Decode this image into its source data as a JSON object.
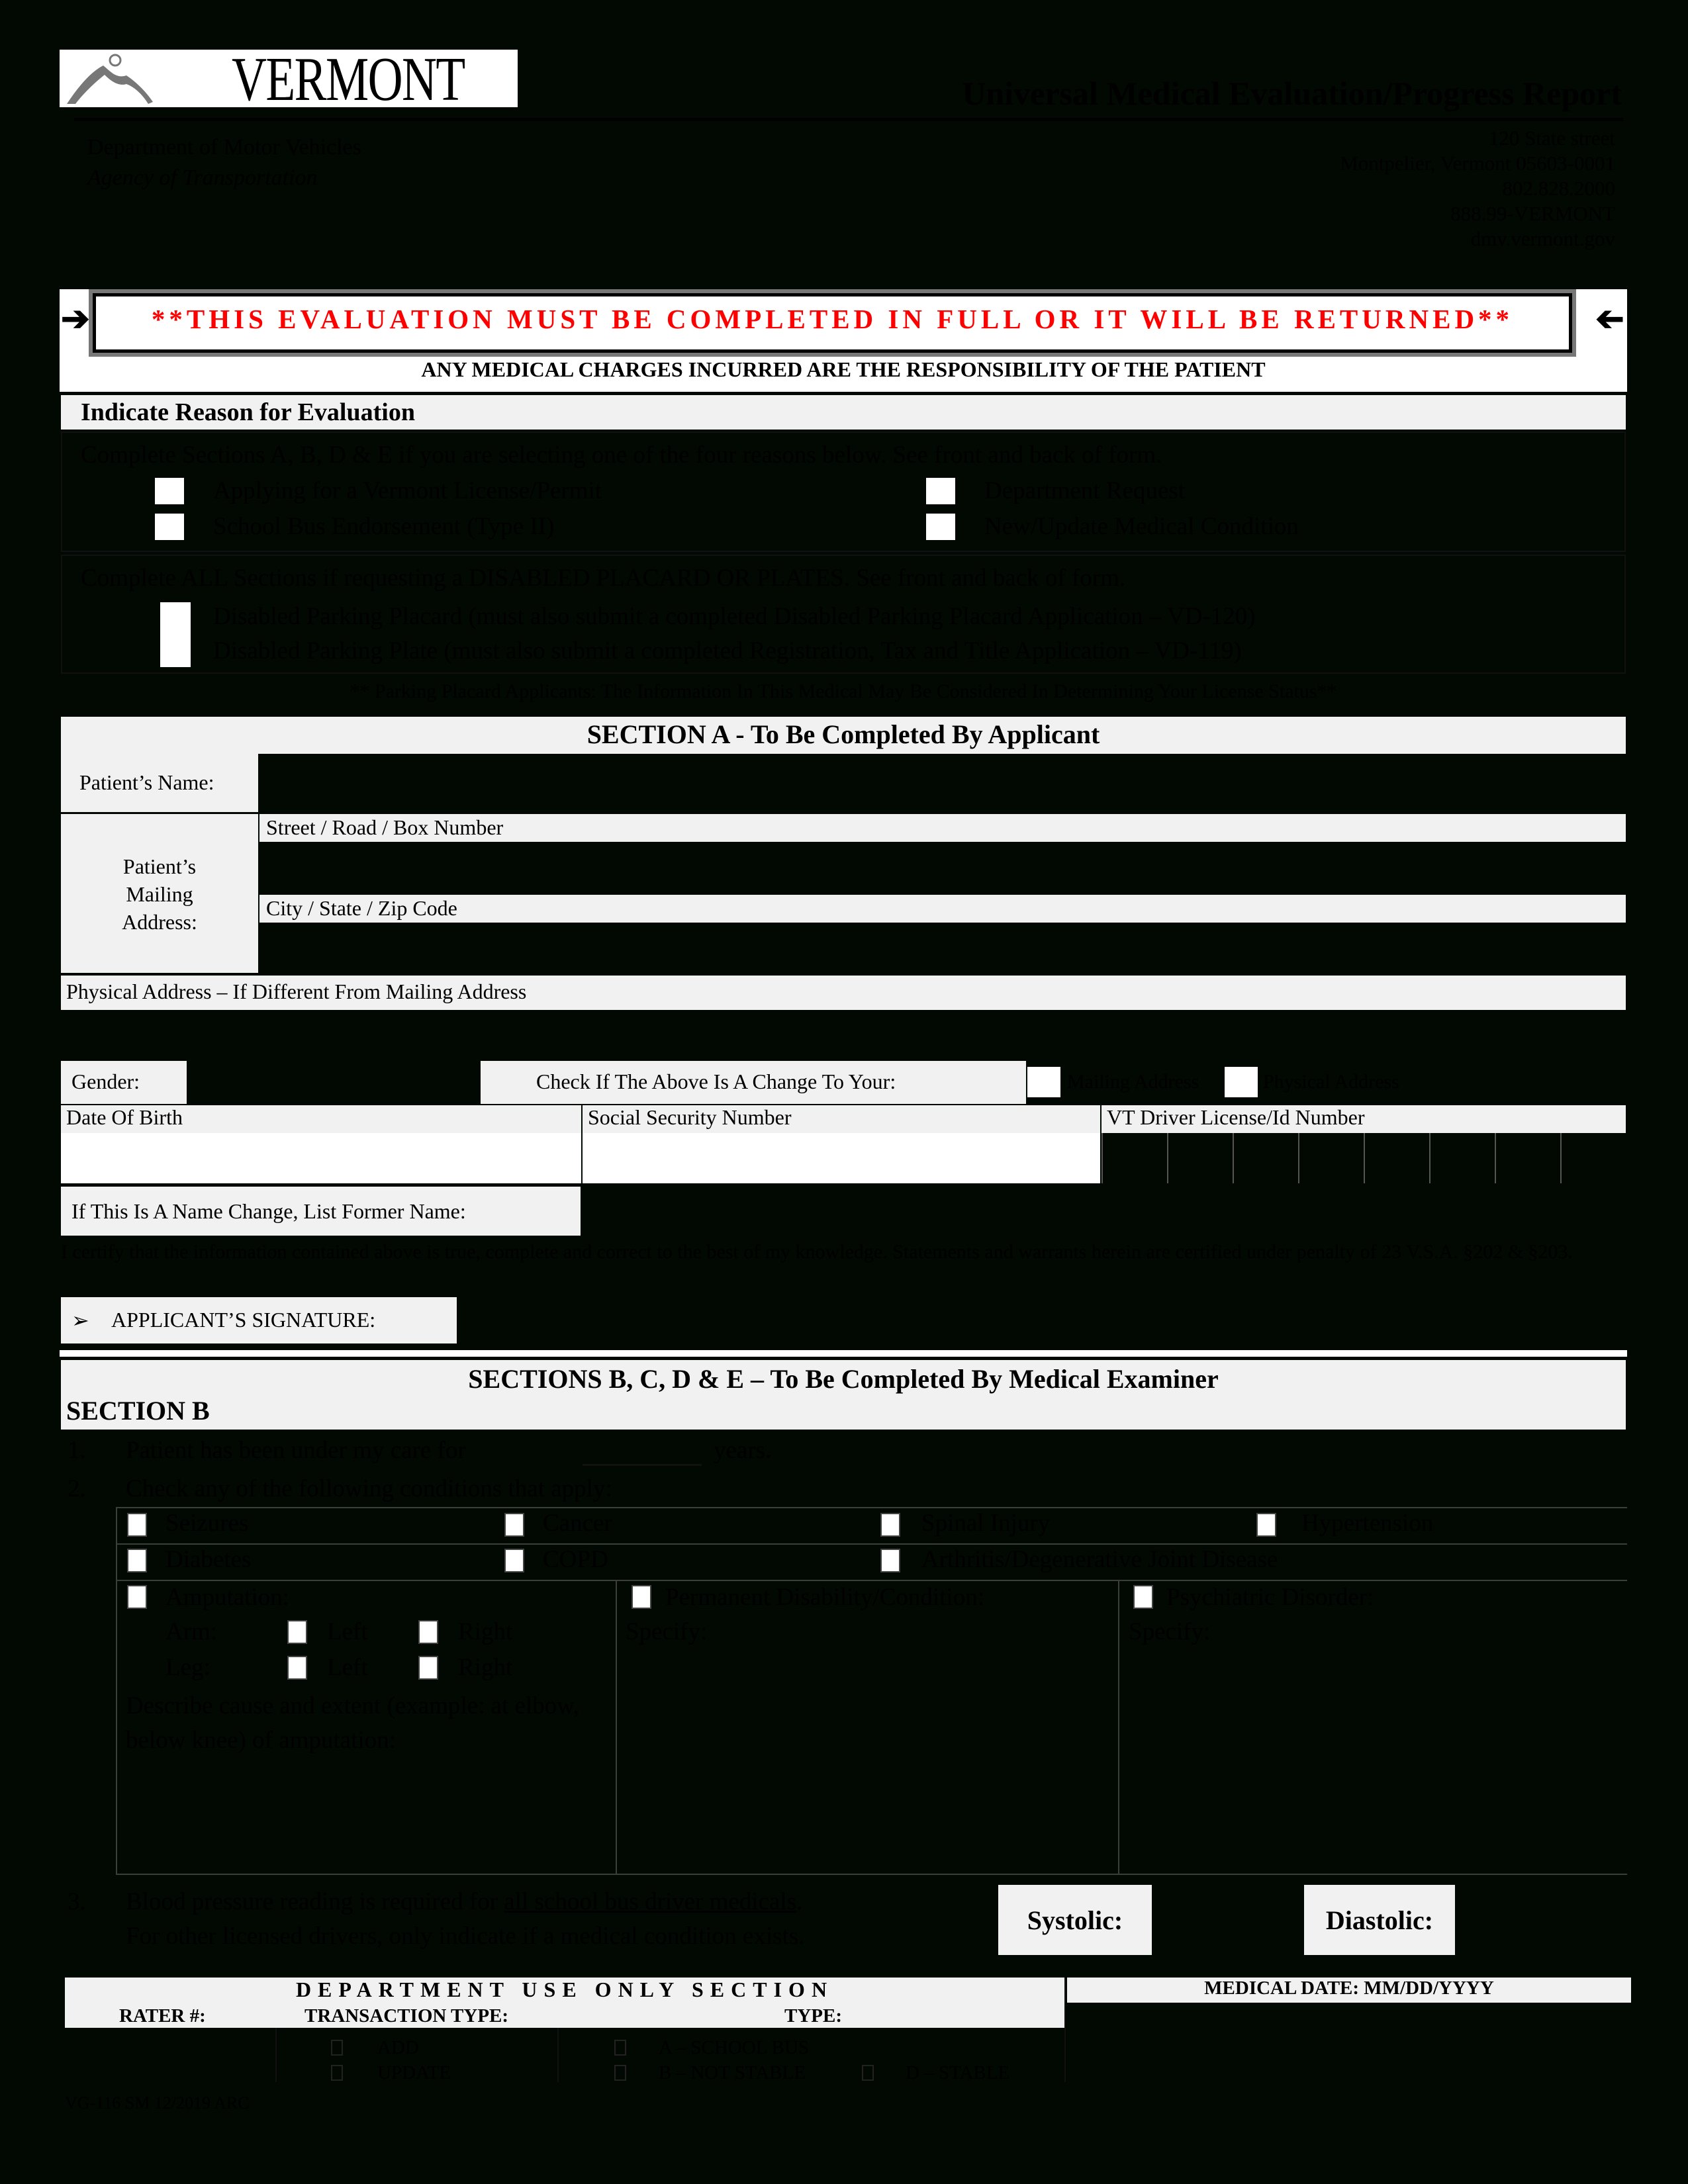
{
  "header": {
    "logo_text": "VERMONT",
    "title": "Universal Medical Evaluation/Progress Report",
    "department": "Department of Motor Vehicles",
    "agency": "Agency of Transportation",
    "address_lines": [
      "120 State street",
      "Montpelier, Vermont 05603-0001",
      "802.828.2000",
      "888.99-VERMONT",
      "dmv.vermont.gov"
    ]
  },
  "banner": {
    "warning": "**THIS EVALUATION MUST BE COMPLETED IN FULL OR IT WILL BE RETURNED**",
    "charges": "ANY MEDICAL CHARGES INCURRED ARE THE RESPONSIBILITY OF THE PATIENT",
    "left_arrow": "➔",
    "right_arrow": "🡐"
  },
  "reason": {
    "heading": "Indicate Reason for Evaluation",
    "group1_intro": "Complete Sections A, B, D & E if you are selecting one of the four reasons below.  See front and back of form.",
    "group1_options": [
      "Applying for a Vermont License/Permit",
      "Department Request",
      "School Bus Endorsement (Type II)",
      "New/Update Medical Condition"
    ],
    "group2_intro": "Complete ALL Sections if requesting a DISABLED PLACARD OR PLATES.  See front and back of form.",
    "group2_options": [
      "Disabled Parking Placard (must also submit a completed Disabled Parking Placard Application – VD-120)",
      "Disabled Parking Plate (must also submit a completed Registration, Tax and Title Application – VD-119)"
    ],
    "note": "** Parking Placard Applicants:  The Information In This Medical May Be Considered In Determining Your License Status**"
  },
  "section_a": {
    "heading": "SECTION A - To Be Completed By Applicant",
    "patient_name_label": "Patient’s Name:",
    "mailing_label_lines": [
      "Patient’s",
      "Mailing",
      "Address:"
    ],
    "street_label": "Street / Road / Box Number",
    "city_label": "City / State / Zip Code",
    "physical_label": "Physical Address – If Different From Mailing Address",
    "gender_label": "Gender:",
    "change_label": "Check If The Above Is A Change To Your:",
    "change_options": [
      "Mailing Address",
      "Physical Address"
    ],
    "dob_label": "Date Of Birth",
    "ssn_label": "Social Security Number",
    "license_label": "VT Driver License/Id Number",
    "license_cells": 8,
    "former_name_label": "If This Is A Name Change, List Former Name:",
    "certify_text": "I certify that the information contained above is true, complete and correct to the best of my knowledge.  Statements and warrants herein are certified under penalty of 23 V.S.A. §202 & §203.",
    "signature_label": "APPLICANT’S SIGNATURE:",
    "signature_bullet": "➢"
  },
  "section_b": {
    "main_heading": "SECTIONS B, C, D & E – To Be Completed By Medical Examiner",
    "heading": "SECTION B",
    "item1_num": "1.",
    "item1_pre": "Patient has been under my care for",
    "item1_post": "years.",
    "item2_num": "2.",
    "item2_text": "Check any of the following conditions that apply:",
    "conditions_row1": [
      "Seizures",
      "Cancer",
      "Spinal Injury",
      "Hypertension"
    ],
    "conditions_row2": [
      "Diabetes",
      "COPD",
      "Arthritis/Degenerative Joint Disease"
    ],
    "amputation": {
      "label": "Amputation:",
      "arm": "Arm:",
      "leg": "Leg:",
      "left": "Left",
      "right": "Right",
      "describe": "Describe cause and extent (example: at elbow, below knee) of amputation:"
    },
    "permanent_disability": "Permanent Disability/Condition:",
    "psychiatric": "Psychiatric Disorder:",
    "specify": "Specify:",
    "item3_num": "3.",
    "item3_line1_pre": "Blood pressure reading is required for ",
    "item3_line1_underlined": "all school bus driver medicals",
    "item3_line1_post": ".",
    "item3_line2": "For other licensed drivers, only indicate if a medical condition exists.",
    "systolic_label": "Systolic:",
    "diastolic_label": "Diastolic:"
  },
  "dept_use": {
    "heading": "DEPARTMENT USE ONLY SECTION",
    "rater_label": "RATER #:",
    "transaction_label": "TRANSACTION TYPE:",
    "type_label": "TYPE:",
    "transaction_options": [
      "ADD",
      "UPDATE"
    ],
    "type_options": [
      "A – SCHOOL BUS",
      "B – NOT STABLE",
      "D – STABLE"
    ],
    "medical_date_label": "MEDICAL DATE: MM/DD/YYYY"
  },
  "footer": {
    "form_id": "VG-116 SM 12/2019 ARC"
  },
  "colors": {
    "background": "#020802",
    "warning_red": "#ff0000",
    "band_gray": "#f1f1f1"
  }
}
